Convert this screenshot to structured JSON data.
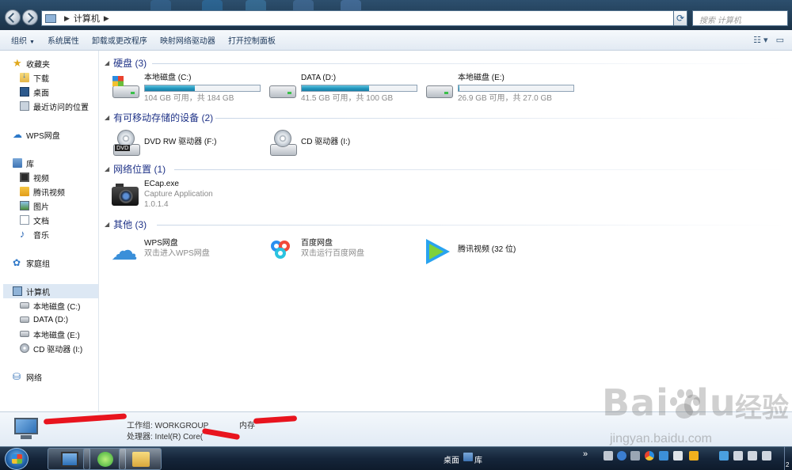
{
  "window": {
    "breadcrumb": "计算机",
    "search_placeholder": "搜索 计算机"
  },
  "toolbar": {
    "items": [
      "组织",
      "系统属性",
      "卸载或更改程序",
      "映射网络驱动器",
      "打开控制面板"
    ]
  },
  "sidebar": {
    "favorites": {
      "label": "收藏夹",
      "items": [
        "下载",
        "桌面",
        "最近访问的位置"
      ]
    },
    "wps": "WPS网盘",
    "libraries": {
      "label": "库",
      "items": [
        "视频",
        "腾讯视频",
        "图片",
        "文档",
        "音乐"
      ]
    },
    "homegroup": "家庭组",
    "computer": {
      "label": "计算机",
      "items": [
        "本地磁盘 (C:)",
        "DATA (D:)",
        "本地磁盘 (E:)",
        "CD 驱动器 (I:)"
      ]
    },
    "network": "网络"
  },
  "groups": {
    "hdd": {
      "title": "硬盘 (3)"
    },
    "removable": {
      "title": "有可移动存储的设备 (2)"
    },
    "netloc": {
      "title": "网络位置 (1)"
    },
    "other": {
      "title": "其他 (3)"
    }
  },
  "drives": [
    {
      "name": "本地磁盘 (C:)",
      "info": "104 GB 可用，共 184 GB",
      "used_fraction": 0.435
    },
    {
      "name": "DATA (D:)",
      "info": "41.5 GB 可用，共 100 GB",
      "used_fraction": 0.585
    },
    {
      "name": "本地磁盘 (E:)",
      "info": "26.9 GB 可用，共 27.0 GB",
      "used_fraction": 0.004
    }
  ],
  "removable": [
    {
      "name": "DVD RW 驱动器 (F:)",
      "label": "DVD"
    },
    {
      "name": "CD 驱动器 (I:)"
    }
  ],
  "netloc": {
    "name": "ECap.exe",
    "desc": "Capture Application",
    "version": "1.0.1.4"
  },
  "other": [
    {
      "name": "WPS网盘",
      "desc": "双击进入WPS网盘"
    },
    {
      "name": "百度网盘",
      "desc": "双击运行百度网盘"
    },
    {
      "name": "腾讯视频 (32 位)"
    }
  ],
  "details": {
    "workgroup": "工作组: WORKGROUP",
    "cpu": "处理器: Intel(R) Core(",
    "memory": "内存"
  },
  "taskbar": {
    "desktop": "桌面",
    "library": "库",
    "overflow": "»",
    "clock_digit": "2"
  },
  "watermark": {
    "brand": "Bai  du",
    "cn": "经验",
    "url": "jingyan.baidu.com"
  }
}
